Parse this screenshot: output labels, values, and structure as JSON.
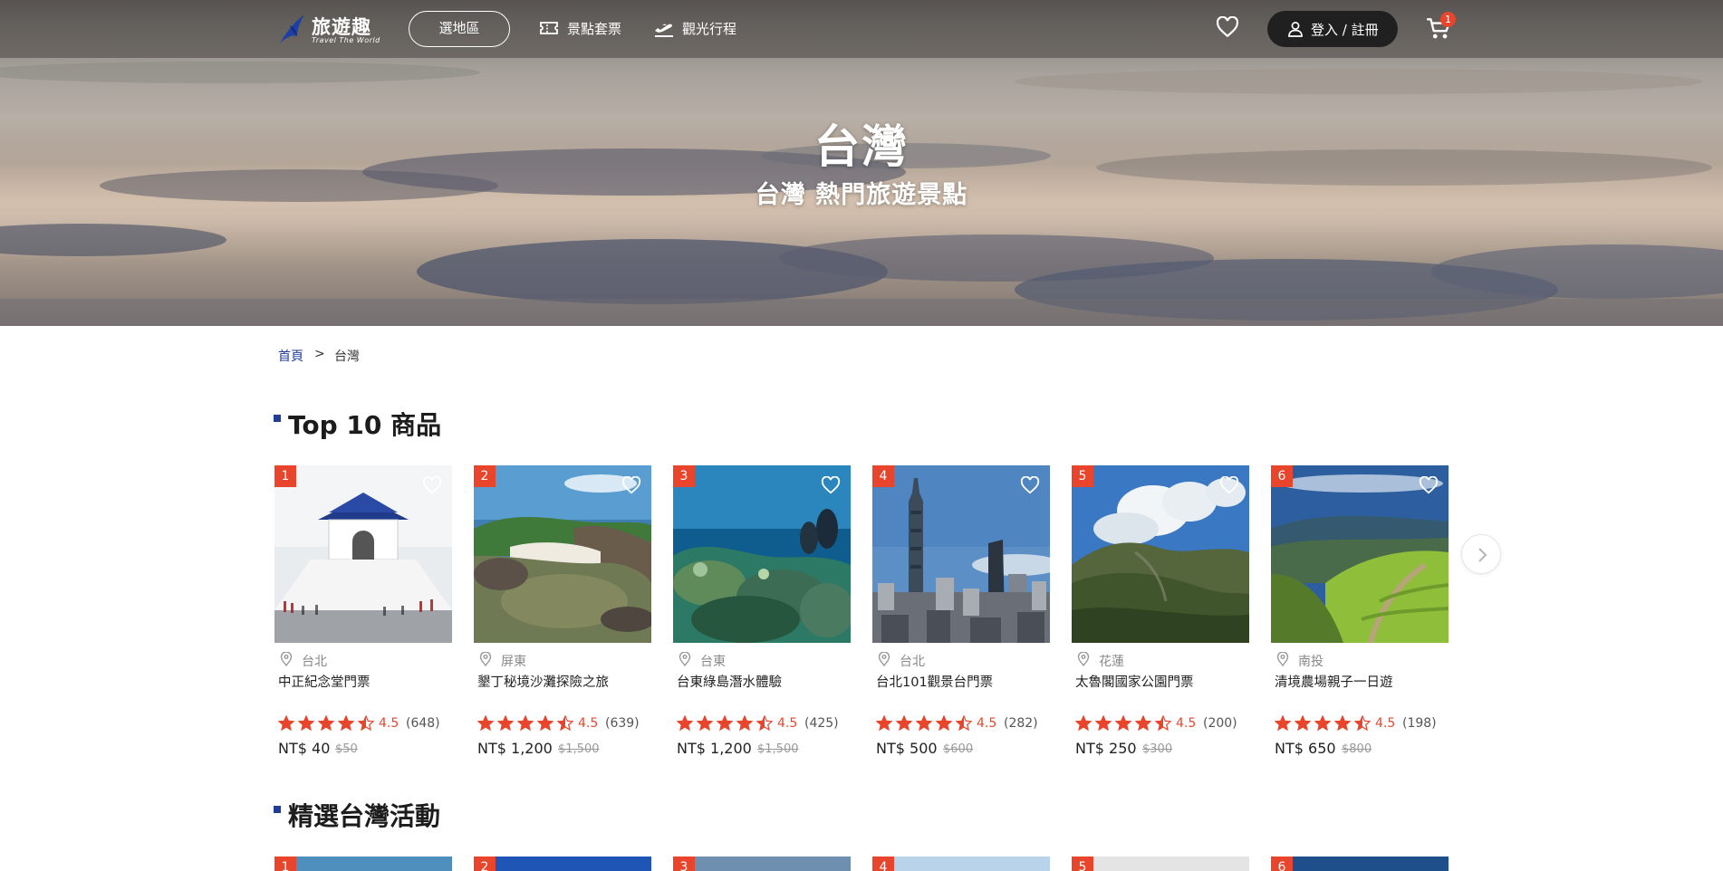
{
  "header": {
    "logo": {
      "name": "旅遊趣",
      "tagline": "Travel The World"
    },
    "region_button": "選地區",
    "nav": [
      {
        "label": "景點套票",
        "icon": "ticket-icon"
      },
      {
        "label": "觀光行程",
        "icon": "airplane-icon"
      }
    ],
    "login_label": "登入 / 註冊",
    "cart_count": "1"
  },
  "hero": {
    "title": "台灣",
    "subtitle": "台灣 熱門旅遊景點"
  },
  "breadcrumb": {
    "home": "首頁",
    "separator": ">",
    "current": "台灣"
  },
  "top10": {
    "title": "Top 10 商品",
    "items": [
      {
        "rank": "1",
        "location": "台北",
        "name": "中正紀念堂門票",
        "rating": "4.5",
        "reviews": "(648)",
        "price": "NT$ 40",
        "original_price": "$50",
        "stars": 4.5
      },
      {
        "rank": "2",
        "location": "屏東",
        "name": "墾丁秘境沙灘探險之旅",
        "rating": "4.5",
        "reviews": "(639)",
        "price": "NT$ 1,200",
        "original_price": "$1,500",
        "stars": 4.5
      },
      {
        "rank": "3",
        "location": "台東",
        "name": "台東綠島潛水體驗",
        "rating": "4.5",
        "reviews": "(425)",
        "price": "NT$ 1,200",
        "original_price": "$1,500",
        "stars": 4.5
      },
      {
        "rank": "4",
        "location": "台北",
        "name": "台北101觀景台門票",
        "rating": "4.5",
        "reviews": "(282)",
        "price": "NT$ 500",
        "original_price": "$600",
        "stars": 4.5
      },
      {
        "rank": "5",
        "location": "花蓮",
        "name": "太魯閣國家公園門票",
        "rating": "4.5",
        "reviews": "(200)",
        "price": "NT$ 250",
        "original_price": "$300",
        "stars": 4.5
      },
      {
        "rank": "6",
        "location": "南投",
        "name": "清境農場親子一日遊",
        "rating": "4.5",
        "reviews": "(198)",
        "price": "NT$ 650",
        "original_price": "$800",
        "stars": 4.5
      }
    ]
  },
  "featured": {
    "title": "精選台灣活動",
    "ranks": [
      "1",
      "2",
      "3",
      "4",
      "5",
      "6"
    ]
  },
  "colors": {
    "accent": "#e8452c",
    "brand": "#1f3d99",
    "dark": "#202020"
  }
}
